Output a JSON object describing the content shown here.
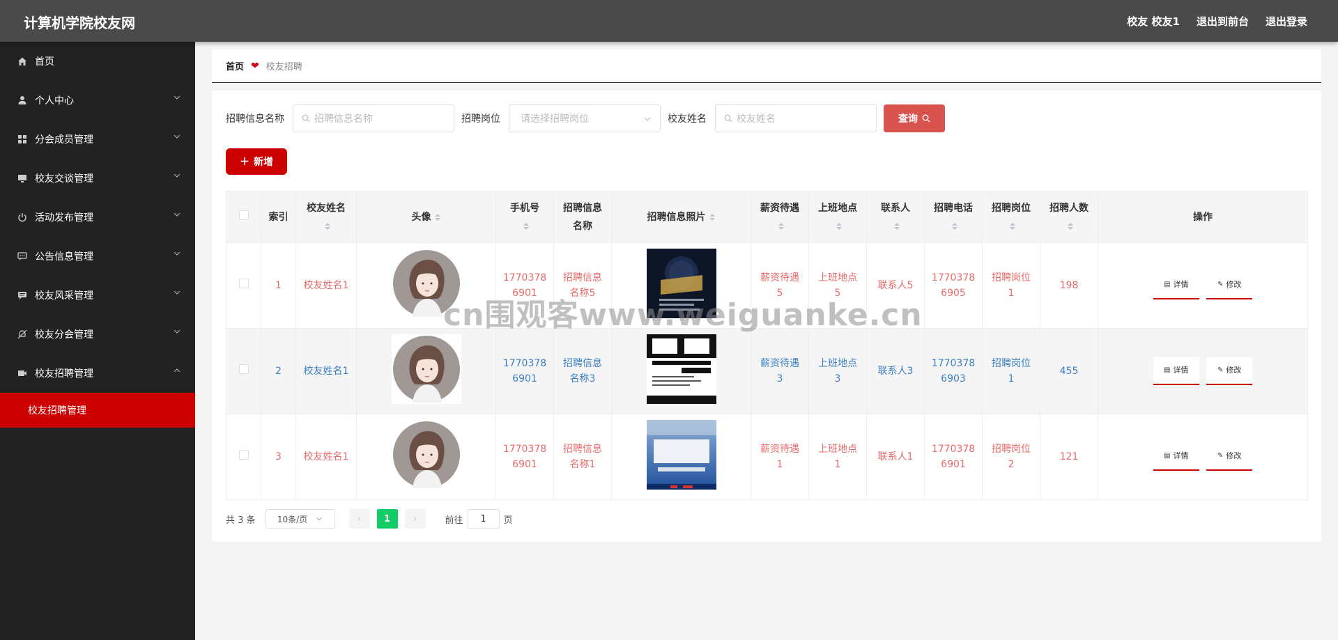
{
  "header": {
    "title": "计算机学院校友网",
    "user": "校友 校友1",
    "to_front": "退出到前台",
    "logout": "退出登录"
  },
  "sidebar": {
    "items": [
      {
        "label": "首页",
        "icon": "home-icon"
      },
      {
        "label": "个人中心",
        "icon": "user-icon"
      },
      {
        "label": "分会成员管理",
        "icon": "grid-icon"
      },
      {
        "label": "校友交谈管理",
        "icon": "monitor-icon"
      },
      {
        "label": "活动发布管理",
        "icon": "power-icon"
      },
      {
        "label": "公告信息管理",
        "icon": "chat-icon"
      },
      {
        "label": "校友风采管理",
        "icon": "message-icon"
      },
      {
        "label": "校友分会管理",
        "icon": "bell-off-icon"
      },
      {
        "label": "校友招聘管理",
        "icon": "camera-icon"
      }
    ],
    "active_sub": "校友招聘管理"
  },
  "breadcrumb": {
    "home": "首页",
    "current": "校友招聘"
  },
  "search": {
    "f1_label": "招聘信息名称",
    "f1_placeholder": "招聘信息名称",
    "f2_label": "招聘岗位",
    "f2_placeholder": "请选择招聘岗位",
    "f3_label": "校友姓名",
    "f3_placeholder": "校友姓名",
    "query_label": "查询"
  },
  "add_label": "新增",
  "table": {
    "headers": {
      "index": "索引",
      "name": "校友姓名",
      "avatar": "头像",
      "phone": "手机号",
      "job_name": "招聘信息名称",
      "photo": "招聘信息照片",
      "salary": "薪资待遇",
      "location": "上班地点",
      "contact": "联系人",
      "tel": "招聘电话",
      "position": "招聘岗位",
      "count": "招聘人数",
      "ops": "操作"
    },
    "rows": [
      {
        "index": "1",
        "name": "校友姓名1",
        "phone": "17703786901",
        "job_name": "招聘信息名称5",
        "salary": "薪资待遇5",
        "location": "上班地点5",
        "contact": "联系人5",
        "tel": "17703786905",
        "position": "招聘岗位1",
        "count": "198"
      },
      {
        "index": "2",
        "name": "校友姓名1",
        "phone": "17703786901",
        "job_name": "招聘信息名称3",
        "salary": "薪资待遇3",
        "location": "上班地点3",
        "contact": "联系人3",
        "tel": "17703786903",
        "position": "招聘岗位1",
        "count": "455"
      },
      {
        "index": "3",
        "name": "校友姓名1",
        "phone": "17703786901",
        "job_name": "招聘信息名称1",
        "salary": "薪资待遇1",
        "location": "上班地点1",
        "contact": "联系人1",
        "tel": "17703786901",
        "position": "招聘岗位2",
        "count": "121"
      }
    ],
    "op_detail": "详情",
    "op_edit": "修改"
  },
  "pager": {
    "total": "共 3 条",
    "page_size": "10条/页",
    "current": "1",
    "goto_label": "前往",
    "goto_value": "1",
    "page_unit": "页"
  },
  "watermark": "cn围观客www.weiguanke.cn",
  "colors": {
    "accent": "#cc0000",
    "sidebar_bg": "#222222",
    "topbar_bg": "#4a4a4a",
    "query_btn": "#d9534f",
    "pager_active": "#13ce66"
  }
}
